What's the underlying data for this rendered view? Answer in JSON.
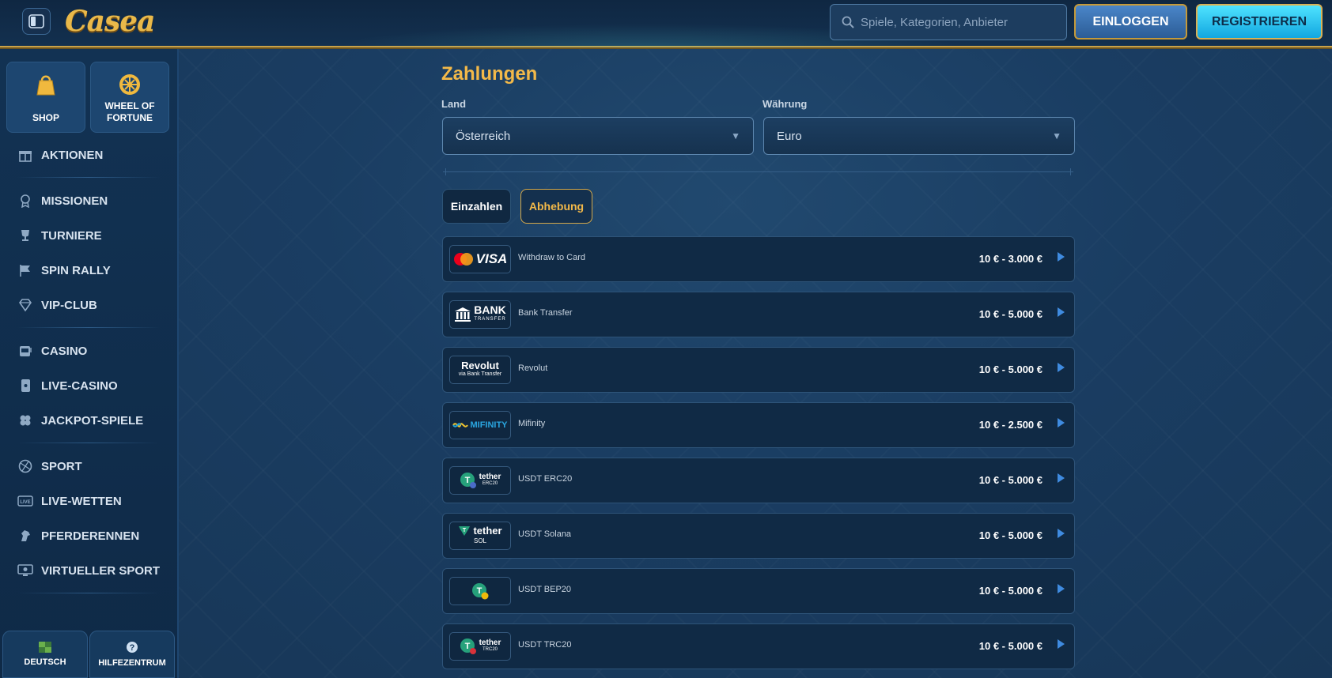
{
  "header": {
    "logo_text": "Casea",
    "search_placeholder": "Spiele, Kategorien, Anbieter",
    "login_label": "EINLOGGEN",
    "register_label": "REGISTRIEREN"
  },
  "sidebar": {
    "tiles": [
      {
        "label": "SHOP",
        "icon": "shopping-bag-icon"
      },
      {
        "label": "WHEEL OF FORTUNE",
        "icon": "wheel-icon"
      }
    ],
    "items": [
      {
        "label": "AKTIONEN",
        "icon": "gift-icon"
      },
      {
        "label": "MISSIONEN",
        "icon": "medal-icon"
      },
      {
        "label": "TURNIERE",
        "icon": "trophy-icon"
      },
      {
        "label": "SPIN RALLY",
        "icon": "flag-icon"
      },
      {
        "label": "VIP-CLUB",
        "icon": "diamond-icon"
      },
      {
        "label": "CASINO",
        "icon": "slot-machine-icon"
      },
      {
        "label": "LIVE-CASINO",
        "icon": "card-icon"
      },
      {
        "label": "JACKPOT-SPIELE",
        "icon": "clover-icon"
      },
      {
        "label": "SPORT",
        "icon": "ball-icon"
      },
      {
        "label": "LIVE-WETTEN",
        "icon": "live-icon"
      },
      {
        "label": "PFERDERENNEN",
        "icon": "horse-icon"
      },
      {
        "label": "VIRTUELLER SPORT",
        "icon": "monitor-icon"
      }
    ],
    "footer": [
      {
        "label": "DEUTSCH",
        "icon": "flag-icon"
      },
      {
        "label": "HILFEZENTRUM",
        "icon": "help-icon"
      }
    ]
  },
  "main": {
    "title": "Zahlungen",
    "country_label": "Land",
    "country_value": "Österreich",
    "currency_label": "Währung",
    "currency_value": "Euro",
    "tabs": [
      {
        "label": "Einzahlen",
        "active": false
      },
      {
        "label": "Abhebung",
        "active": true
      }
    ],
    "methods": [
      {
        "logo": "visa",
        "name": "Withdraw to Card",
        "range": "10 € - 3.000 €"
      },
      {
        "logo": "bank",
        "name": "Bank Transfer",
        "range": "10 € - 5.000 €"
      },
      {
        "logo": "revolut",
        "name": "Revolut",
        "range": "10 € - 5.000 €"
      },
      {
        "logo": "mifinity",
        "name": "Mifinity",
        "range": "10 € - 2.500 €"
      },
      {
        "logo": "tether-erc20",
        "name": "USDT ERC20",
        "range": "10 € - 5.000 €"
      },
      {
        "logo": "tether-sol",
        "name": "USDT Solana",
        "range": "10 € - 5.000 €"
      },
      {
        "logo": "tether-bep20",
        "name": "USDT BEP20",
        "range": "10 € - 5.000 €"
      },
      {
        "logo": "tether-trc20",
        "name": "USDT TRC20",
        "range": "10 € - 5.000 €"
      }
    ],
    "logo_texts": {
      "visa": "VISA",
      "bank_main": "BANK",
      "bank_sub": "TRANSFER",
      "revolut_main": "Revolut",
      "revolut_sub": "via Bank Transfer",
      "mifinity": "MIFINITY",
      "tether": "tether",
      "erc20": "ERC20",
      "sol": "SOL",
      "trc20": "TRC20"
    }
  },
  "colors": {
    "accent_gold": "#f3b949",
    "background": "#1a3a5c",
    "register_cyan": "#4fe3ff",
    "arrow_blue": "#3f8be0"
  }
}
